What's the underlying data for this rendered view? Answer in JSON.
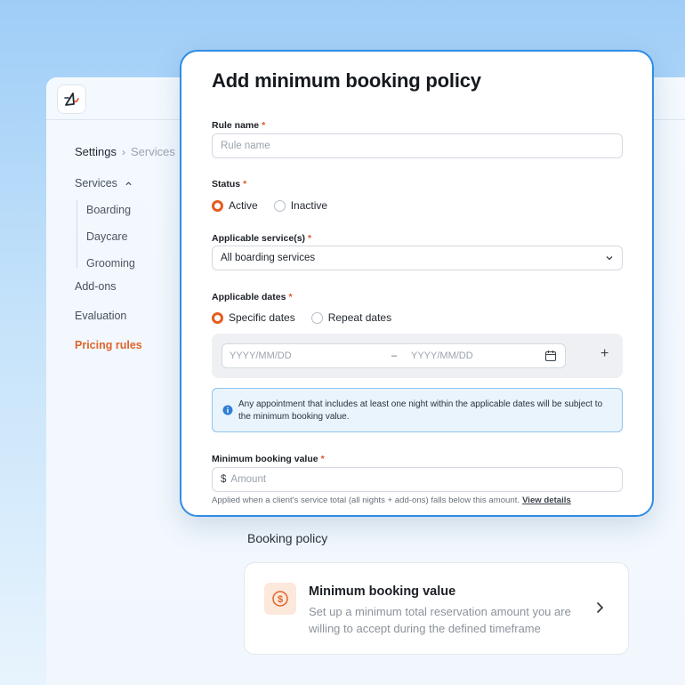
{
  "sidebar": {
    "breadcrumb": {
      "root": "Settings",
      "current": "Services"
    },
    "items": [
      {
        "label": "Services"
      },
      {
        "label": "Boarding"
      },
      {
        "label": "Daycare"
      },
      {
        "label": "Grooming"
      },
      {
        "label": "Add-ons"
      },
      {
        "label": "Evaluation"
      },
      {
        "label": "Pricing rules"
      }
    ]
  },
  "modal": {
    "title": "Add minimum booking policy",
    "rule_name": {
      "label": "Rule name",
      "placeholder": "Rule name",
      "required": "*"
    },
    "status": {
      "label": "Status",
      "required": "*",
      "options": [
        "Active",
        "Inactive"
      ],
      "selected": "Active"
    },
    "services": {
      "label": "Applicable service(s)",
      "required": "*",
      "value": "All boarding services"
    },
    "dates": {
      "label": "Applicable dates",
      "required": "*",
      "options": [
        "Specific dates",
        "Repeat dates"
      ],
      "selected": "Specific dates",
      "start_placeholder": "YYYY/MM/DD",
      "separator": "–",
      "end_placeholder": "YYYY/MM/DD",
      "add": "+"
    },
    "info": "Any appointment that includes at least one night within the applicable dates will be subject to the minimum booking value.",
    "min_value": {
      "label": "Minimum booking value",
      "required": "*",
      "currency": "$",
      "placeholder": "Amount",
      "hint": "Applied when a client's service total (all nights + add-ons) falls below this amount.",
      "link": "View details"
    }
  },
  "booking_policy": {
    "title": "Booking policy",
    "card": {
      "title": "Minimum booking value",
      "description": "Set up a minimum total reservation amount you are willing to accept during the defined timeframe"
    }
  },
  "colors": {
    "accent": "#e45c20",
    "border_focus": "#2f8de4",
    "info_bg": "#eaf4fd"
  }
}
